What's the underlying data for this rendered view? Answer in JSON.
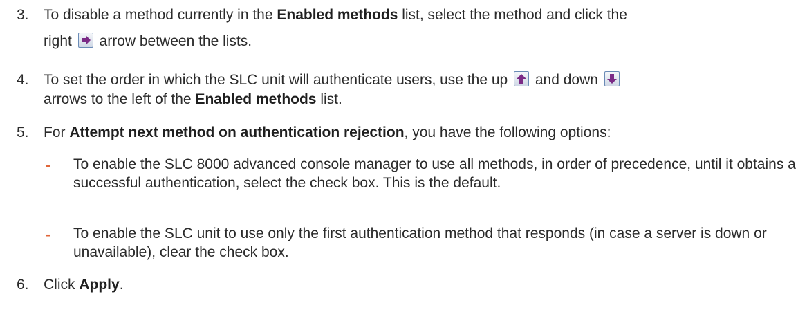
{
  "steps": [
    {
      "number": "3.",
      "part1": "To disable a method currently in the ",
      "bold1": "Enabled methods",
      "part2": " list, select the method and click the",
      "part3": "right ",
      "icon": "right-arrow-icon",
      "part4": " arrow between the lists."
    },
    {
      "number": "4.",
      "part1": "To set the order in which the SLC unit will authenticate users, use the up ",
      "icon_up": "up-arrow-icon",
      "part2": " and down ",
      "icon_down": "down-arrow-icon",
      "part3": "arrows to the left of the ",
      "bold1": "Enabled methods",
      "part4": " list."
    },
    {
      "number": "5.",
      "part1": "For ",
      "bold1": "Attempt next method on authentication rejection",
      "part2": ", you have the following options:",
      "options": [
        "To enable the SLC 8000 advanced console manager to use all methods, in order of precedence, until it obtains a successful authentication, select the check box. This is the default.",
        "To enable the SLC unit to use only the first authentication method that responds (in case a server is down or unavailable), clear the check box."
      ]
    },
    {
      "number": "6.",
      "part1": "Click ",
      "bold1": "Apply",
      "part2": "."
    }
  ],
  "bullet": "-",
  "colors": {
    "text": "#2b2b2b",
    "bullet": "#e0663a",
    "icon_arrow": "#7b2b86"
  }
}
